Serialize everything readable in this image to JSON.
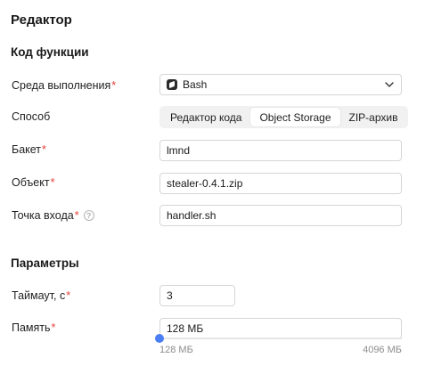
{
  "title": "Редактор",
  "section_code": "Код функции",
  "runtime": {
    "label": "Среда выполнения",
    "value": "Bash"
  },
  "method": {
    "label": "Способ",
    "options": [
      "Редактор кода",
      "Object Storage",
      "ZIP-архив"
    ],
    "selected": "Object Storage"
  },
  "bucket": {
    "label": "Бакет",
    "value": "lmnd"
  },
  "object": {
    "label": "Объект",
    "value": "stealer-0.4.1.zip"
  },
  "entrypoint": {
    "label": "Точка входа",
    "help": "?",
    "value": "handler.sh"
  },
  "section_params": "Параметры",
  "timeout": {
    "label": "Таймаут, с",
    "value": "3"
  },
  "memory": {
    "label": "Память",
    "value": "128 МБ",
    "slider_min": "128 МБ",
    "slider_max": "4096 МБ",
    "slider_fraction": 0
  },
  "required_mark": "*",
  "colors": {
    "required": "#e5413b",
    "slider": "#4c7ff4"
  }
}
